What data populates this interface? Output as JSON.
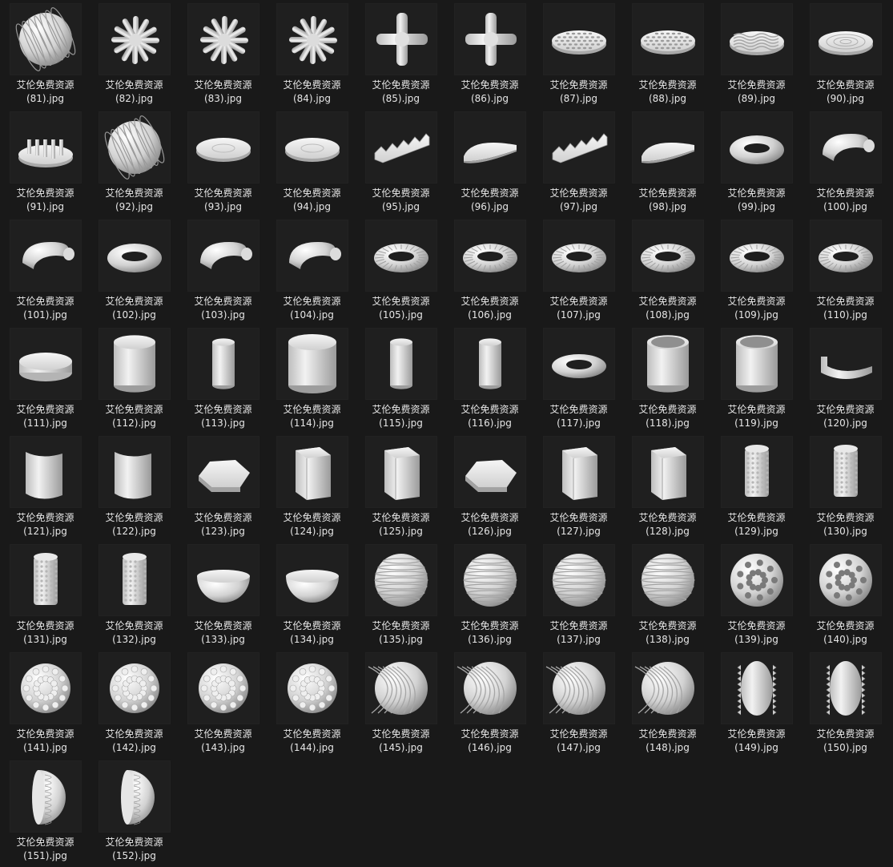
{
  "colors": {
    "background": "#191919",
    "thumb_bg": "#1f1f1f",
    "text": "#e6e6e6",
    "object": "#d9d9d9"
  },
  "files": [
    {
      "line1": "艾伦免费资源",
      "line2": "(81).jpg",
      "icon": "ribbed-sphere-icon"
    },
    {
      "line1": "艾伦免费资源",
      "line2": "(82).jpg",
      "icon": "spiky-burst-icon"
    },
    {
      "line1": "艾伦免费资源",
      "line2": "(83).jpg",
      "icon": "spiky-burst-icon"
    },
    {
      "line1": "艾伦免费资源",
      "line2": "(84).jpg",
      "icon": "spiky-burst-icon"
    },
    {
      "line1": "艾伦免费资源",
      "line2": "(85).jpg",
      "icon": "pipe-cross-icon"
    },
    {
      "line1": "艾伦免费资源",
      "line2": "(86).jpg",
      "icon": "pipe-cross-icon"
    },
    {
      "line1": "艾伦免费资源",
      "line2": "(87).jpg",
      "icon": "perforated-disc-icon"
    },
    {
      "line1": "艾伦免费资源",
      "line2": "(88).jpg",
      "icon": "perforated-disc-icon"
    },
    {
      "line1": "艾伦免费资源",
      "line2": "(89).jpg",
      "icon": "wavy-disc-icon"
    },
    {
      "line1": "艾伦免费资源",
      "line2": "(90).jpg",
      "icon": "ringed-disc-icon"
    },
    {
      "line1": "艾伦免费资源",
      "line2": "(91).jpg",
      "icon": "studded-disc-icon"
    },
    {
      "line1": "艾伦免费资源",
      "line2": "(92).jpg",
      "icon": "striped-sphere-icon"
    },
    {
      "line1": "艾伦免费资源",
      "line2": "(93).jpg",
      "icon": "flat-disc-icon"
    },
    {
      "line1": "艾伦免费资源",
      "line2": "(94).jpg",
      "icon": "flat-disc-icon"
    },
    {
      "line1": "艾伦免费资源",
      "line2": "(95).jpg",
      "icon": "zigzag-slab-icon"
    },
    {
      "line1": "艾伦免费资源",
      "line2": "(96).jpg",
      "icon": "half-disc-icon"
    },
    {
      "line1": "艾伦免费资源",
      "line2": "(97).jpg",
      "icon": "zigzag-slab-icon"
    },
    {
      "line1": "艾伦免费资源",
      "line2": "(98).jpg",
      "icon": "half-disc-icon"
    },
    {
      "line1": "艾伦免费资源",
      "line2": "(99).jpg",
      "icon": "torus-icon"
    },
    {
      "line1": "艾伦免费资源",
      "line2": "(100).jpg",
      "icon": "half-torus-icon"
    },
    {
      "line1": "艾伦免费资源",
      "line2": "(101).jpg",
      "icon": "tube-icon"
    },
    {
      "line1": "艾伦免费资源",
      "line2": "(102).jpg",
      "icon": "flat-ring-icon"
    },
    {
      "line1": "艾伦免费资源",
      "line2": "(103).jpg",
      "icon": "half-torus-icon"
    },
    {
      "line1": "艾伦免费资源",
      "line2": "(104).jpg",
      "icon": "half-torus-icon"
    },
    {
      "line1": "艾伦免费资源",
      "line2": "(105).jpg",
      "icon": "ribbed-torus-icon"
    },
    {
      "line1": "艾伦免费资源",
      "line2": "(106).jpg",
      "icon": "ribbed-torus-icon"
    },
    {
      "line1": "艾伦免费资源",
      "line2": "(107).jpg",
      "icon": "ribbed-torus-icon"
    },
    {
      "line1": "艾伦免费资源",
      "line2": "(108).jpg",
      "icon": "twisted-ring-icon"
    },
    {
      "line1": "艾伦免费资源",
      "line2": "(109).jpg",
      "icon": "twisted-ring-icon"
    },
    {
      "line1": "艾伦免费资源",
      "line2": "(110).jpg",
      "icon": "twisted-ring-icon"
    },
    {
      "line1": "艾伦免费资源",
      "line2": "(111).jpg",
      "icon": "cylinder-disc-icon"
    },
    {
      "line1": "艾伦免费资源",
      "line2": "(112).jpg",
      "icon": "cylinder-icon"
    },
    {
      "line1": "艾伦免费资源",
      "line2": "(113).jpg",
      "icon": "tall-cylinder-icon"
    },
    {
      "line1": "艾伦免费资源",
      "line2": "(114).jpg",
      "icon": "half-cylinder-icon"
    },
    {
      "line1": "艾伦免费资源",
      "line2": "(115).jpg",
      "icon": "tall-cylinder-icon"
    },
    {
      "line1": "艾伦免费资源",
      "line2": "(116).jpg",
      "icon": "tall-cylinder-icon"
    },
    {
      "line1": "艾伦免费资源",
      "line2": "(117).jpg",
      "icon": "thick-ring-icon"
    },
    {
      "line1": "艾伦免费资源",
      "line2": "(118).jpg",
      "icon": "hollow-cylinder-icon"
    },
    {
      "line1": "艾伦免费资源",
      "line2": "(119).jpg",
      "icon": "hollow-cylinder-icon"
    },
    {
      "line1": "艾伦免费资源",
      "line2": "(120).jpg",
      "icon": "half-ring-icon"
    },
    {
      "line1": "艾伦免费资源",
      "line2": "(121).jpg",
      "icon": "curved-panel-icon"
    },
    {
      "line1": "艾伦免费资源",
      "line2": "(122).jpg",
      "icon": "curved-panel-icon"
    },
    {
      "line1": "艾伦免费资源",
      "line2": "(123).jpg",
      "icon": "hex-slab-icon"
    },
    {
      "line1": "艾伦免费资源",
      "line2": "(124).jpg",
      "icon": "hex-prism-icon"
    },
    {
      "line1": "艾伦免费资源",
      "line2": "(125).jpg",
      "icon": "hex-prism-icon"
    },
    {
      "line1": "艾伦免费资源",
      "line2": "(126).jpg",
      "icon": "hex-slab-icon"
    },
    {
      "line1": "艾伦免费资源",
      "line2": "(127).jpg",
      "icon": "hex-prism-icon"
    },
    {
      "line1": "艾伦免费资源",
      "line2": "(128).jpg",
      "icon": "hex-prism-icon"
    },
    {
      "line1": "艾伦免费资源",
      "line2": "(129).jpg",
      "icon": "dotted-cylinder-icon"
    },
    {
      "line1": "艾伦免费资源",
      "line2": "(130).jpg",
      "icon": "dotted-cylinder-icon"
    },
    {
      "line1": "艾伦免费资源",
      "line2": "(131).jpg",
      "icon": "dotted-cylinder-icon"
    },
    {
      "line1": "艾伦免费资源",
      "line2": "(132).jpg",
      "icon": "dotted-cylinder-icon"
    },
    {
      "line1": "艾伦免费资源",
      "line2": "(133).jpg",
      "icon": "hemisphere-icon"
    },
    {
      "line1": "艾伦免费资源",
      "line2": "(134).jpg",
      "icon": "hemisphere-icon"
    },
    {
      "line1": "艾伦免费资源",
      "line2": "(135).jpg",
      "icon": "banded-sphere-icon"
    },
    {
      "line1": "艾伦免费资源",
      "line2": "(136).jpg",
      "icon": "banded-sphere-icon"
    },
    {
      "line1": "艾伦免费资源",
      "line2": "(137).jpg",
      "icon": "banded-sphere-icon"
    },
    {
      "line1": "艾伦免费资源",
      "line2": "(138).jpg",
      "icon": "banded-sphere-icon"
    },
    {
      "line1": "艾伦免费资源",
      "line2": "(139).jpg",
      "icon": "holey-sphere-icon"
    },
    {
      "line1": "艾伦免费资源",
      "line2": "(140).jpg",
      "icon": "holey-sphere-icon"
    },
    {
      "line1": "艾伦免费资源",
      "line2": "(141).jpg",
      "icon": "bumpy-sphere-icon"
    },
    {
      "line1": "艾伦免费资源",
      "line2": "(142).jpg",
      "icon": "bumpy-sphere-icon"
    },
    {
      "line1": "艾伦免费资源",
      "line2": "(143).jpg",
      "icon": "bumpy-sphere-icon"
    },
    {
      "line1": "艾伦免费资源",
      "line2": "(144).jpg",
      "icon": "bumpy-sphere-icon"
    },
    {
      "line1": "艾伦免费资源",
      "line2": "(145).jpg",
      "icon": "swirl-sphere-icon"
    },
    {
      "line1": "艾伦免费资源",
      "line2": "(146).jpg",
      "icon": "swirl-sphere-icon"
    },
    {
      "line1": "艾伦免费资源",
      "line2": "(147).jpg",
      "icon": "swirl-sphere-icon"
    },
    {
      "line1": "艾伦免费资源",
      "line2": "(148).jpg",
      "icon": "swirl-sphere-icon"
    },
    {
      "line1": "艾伦免费资源",
      "line2": "(149).jpg",
      "icon": "fluted-lens-icon"
    },
    {
      "line1": "艾伦免费资源",
      "line2": "(150).jpg",
      "icon": "fluted-lens-icon"
    },
    {
      "line1": "艾伦免费资源",
      "line2": "(151).jpg",
      "icon": "fluted-half-icon"
    },
    {
      "line1": "艾伦免费资源",
      "line2": "(152).jpg",
      "icon": "fluted-half-icon"
    }
  ]
}
